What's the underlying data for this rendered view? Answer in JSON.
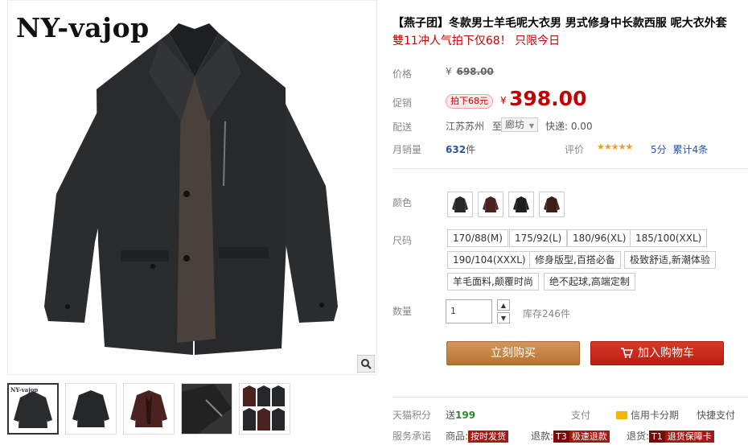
{
  "gallery": {
    "brand": "NY-vajop",
    "thumb_brand": "NY-vajop",
    "thumbnails": [
      {
        "name": "thumb-black-front"
      },
      {
        "name": "thumb-black-back"
      },
      {
        "name": "thumb-brown"
      },
      {
        "name": "thumb-detail"
      },
      {
        "name": "thumb-multi"
      }
    ]
  },
  "product": {
    "title": "【燕子团】冬款男士羊毛呢大衣男 男式修身中长款西服 呢大衣外套",
    "subtitle": "雙11冲人气拍下仅68！ 只限今日"
  },
  "price": {
    "label": "价格",
    "currency": "¥",
    "original": "698.00"
  },
  "promo": {
    "label": "促销",
    "badge": "拍下68元",
    "currency": "¥",
    "price": "398.00"
  },
  "shipping": {
    "label": "配送",
    "from": "江苏苏州",
    "to_word": "至",
    "to": "廊坊",
    "fee": "快递: 0.00"
  },
  "sales": {
    "label": "月销量",
    "count": "632",
    "unit": "件",
    "rating_label": "评价",
    "stars": "★★★★★",
    "score": "5分",
    "reviews": "累计4条"
  },
  "color": {
    "label": "颜色"
  },
  "size": {
    "label": "尺码",
    "options": [
      "170/88(M)",
      "175/92(L)",
      "180/96(XL)",
      "185/100(XXL)",
      "190/104(XXXL)",
      "修身版型,百搭必备",
      "极致舒适,新潮体验",
      "羊毛面料,颠覆时尚",
      "绝不起球,高端定制"
    ]
  },
  "quantity": {
    "label": "数量",
    "value": "1",
    "stock": "库存246件"
  },
  "actions": {
    "buy_now": "立刻购买",
    "add_cart": "加入购物车"
  },
  "services": {
    "points_label": "天猫积分",
    "points_prefix": "送",
    "points": "199",
    "pay_label": "支付",
    "credit": "信用卡分期",
    "quick_pay": "快捷支付",
    "promise_label": "服务承诺",
    "goods_label": "商品:",
    "goods_tag": "按时发货",
    "refund_label": "退款:",
    "refund_t": "T3",
    "refund_tag": "极速退款",
    "return_label": "退货:",
    "return_t": "T1",
    "return_tag": "退货保障卡"
  },
  "colors": {
    "price_red": "#c40000",
    "buy_btn": "#c27f3b",
    "cart_btn": "#c8281b",
    "coat_black": "#262728",
    "coat_brown": "#4a2320"
  }
}
